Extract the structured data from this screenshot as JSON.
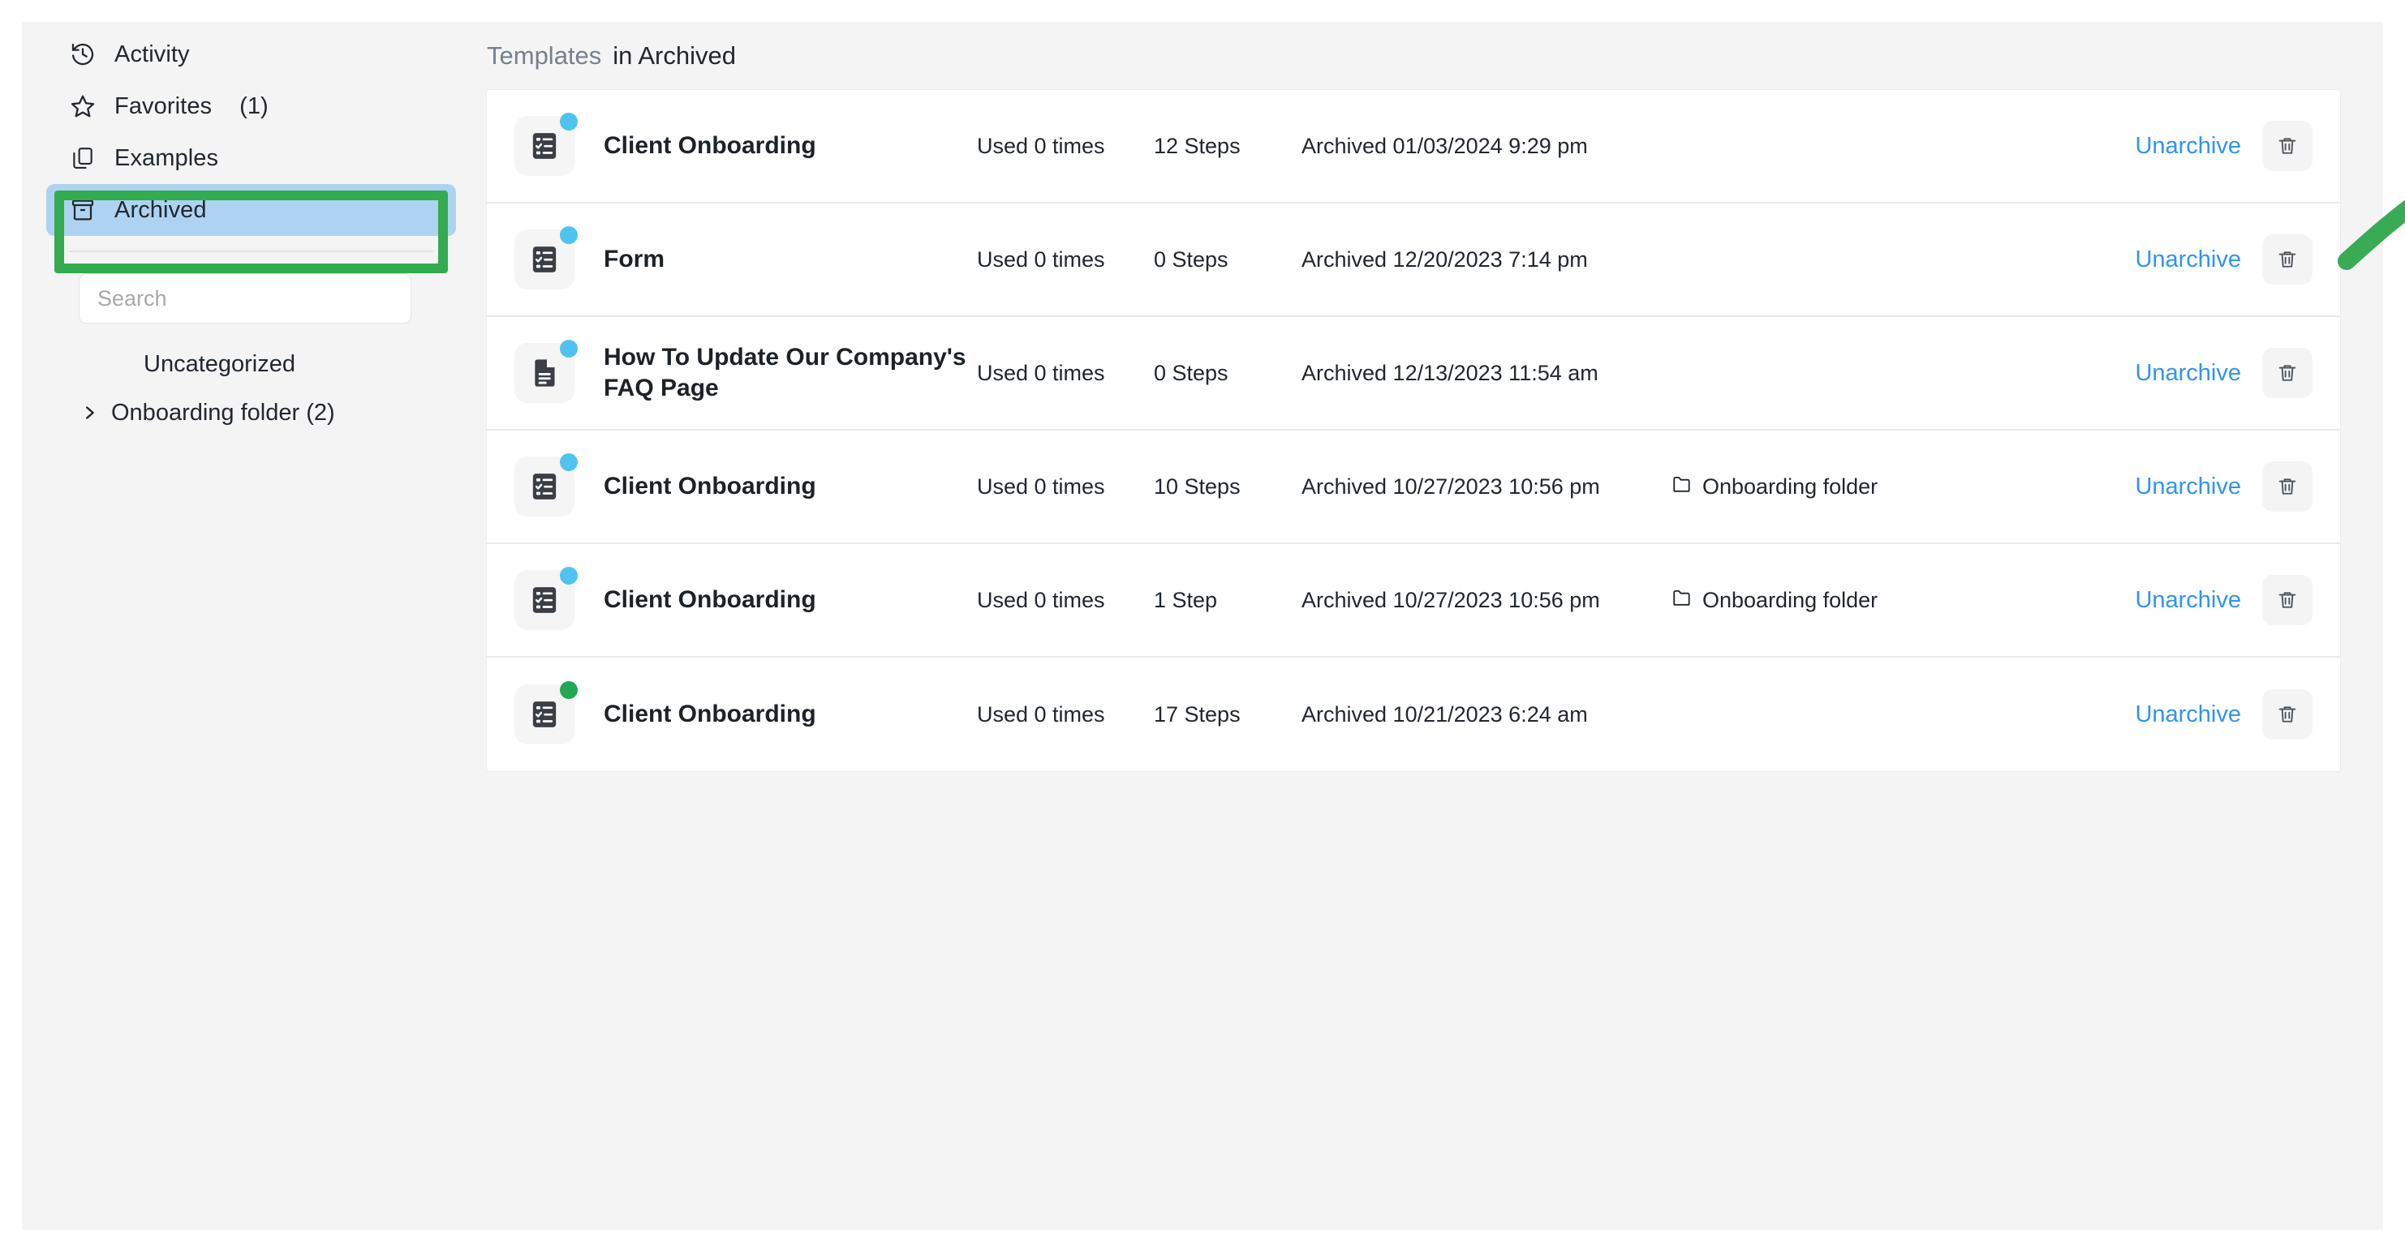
{
  "sidebar": {
    "nav": [
      {
        "label": "Activity",
        "icon": "history-icon",
        "count": ""
      },
      {
        "label": "Favorites",
        "icon": "star-icon",
        "count": "(1)"
      },
      {
        "label": "Examples",
        "icon": "copy-icon",
        "count": ""
      },
      {
        "label": "Archived",
        "icon": "archive-box-icon",
        "count": "",
        "selected": true
      }
    ],
    "search": {
      "placeholder": "Search",
      "value": ""
    },
    "tree": [
      {
        "label": "Uncategorized",
        "chevron": false
      },
      {
        "label": "Onboarding folder (2)",
        "chevron": true
      }
    ]
  },
  "header": {
    "muted": "Templates",
    "strong": "in Archived"
  },
  "table": {
    "unarchive_label": "Unarchive",
    "trash_icon": "trash-icon",
    "folder_icon": "folder-icon",
    "rows": [
      {
        "title": "Client Onboarding",
        "icon": "checklist-icon",
        "badge": "blue",
        "used": "Used 0 times",
        "steps": "12 Steps",
        "archived": "Archived 01/03/2024 9:29 pm",
        "folder": ""
      },
      {
        "title": "Form",
        "icon": "checklist-icon",
        "badge": "blue",
        "used": "Used 0 times",
        "steps": "0 Steps",
        "archived": "Archived 12/20/2023 7:14 pm",
        "folder": ""
      },
      {
        "title": "How To Update Our Company's FAQ Page",
        "icon": "document-icon",
        "badge": "blue",
        "used": "Used 0 times",
        "steps": "0 Steps",
        "archived": "Archived 12/13/2023 11:54 am",
        "folder": ""
      },
      {
        "title": "Client Onboarding",
        "icon": "checklist-icon",
        "badge": "blue",
        "used": "Used 0 times",
        "steps": "10 Steps",
        "archived": "Archived 10/27/2023 10:56 pm",
        "folder": "Onboarding folder"
      },
      {
        "title": "Client Onboarding",
        "icon": "checklist-icon",
        "badge": "blue",
        "used": "Used 0 times",
        "steps": "1 Step",
        "archived": "Archived 10/27/2023 10:56 pm",
        "folder": "Onboarding folder"
      },
      {
        "title": "Client Onboarding",
        "icon": "checklist-icon",
        "badge": "green",
        "used": "Used 0 times",
        "steps": "17 Steps",
        "archived": "Archived 10/21/2023 6:24 am",
        "folder": ""
      }
    ]
  },
  "annotations": {
    "highlight_color": "#33ab4f",
    "arrow_color": "#3aab55",
    "link_color": "#2f94f5",
    "selected_nav_color": "#aed3f2"
  }
}
